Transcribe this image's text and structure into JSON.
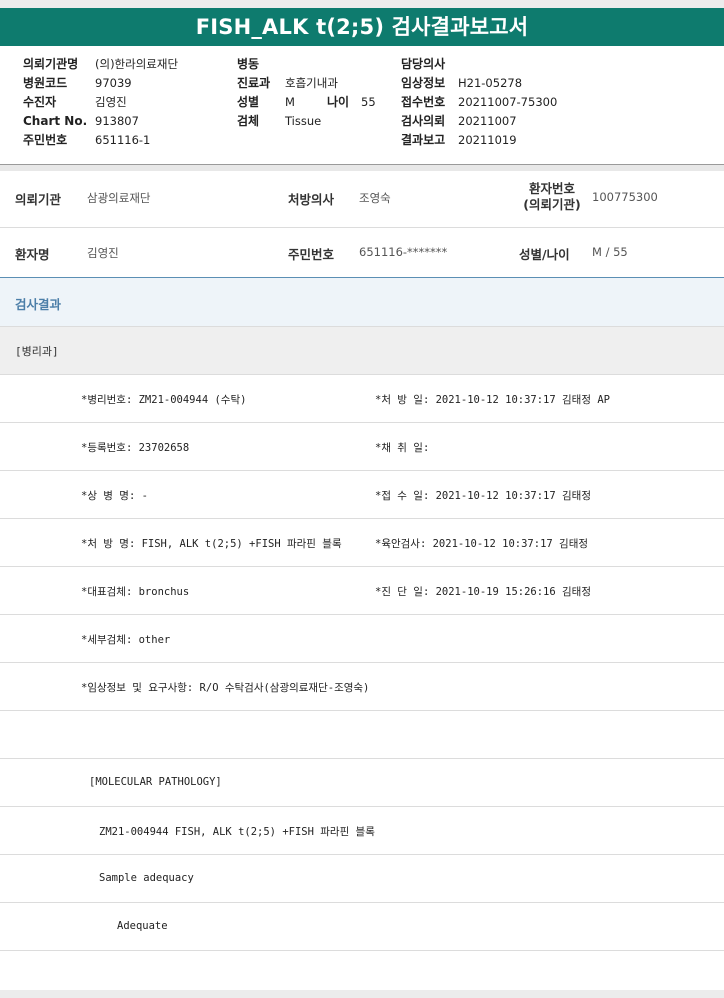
{
  "title": "FISH_ALK t(2;5) 검사결과보고서",
  "header": {
    "col1": [
      {
        "label": "의뢰기관명",
        "value": "(의)한라의료재단"
      },
      {
        "label": "병원코드",
        "value": "97039"
      },
      {
        "label": "수진자",
        "value": "김영진"
      },
      {
        "label": "Chart No.",
        "value": "913807"
      },
      {
        "label": "주민번호",
        "value": "651116-1"
      }
    ],
    "col2": [
      {
        "label": "병동",
        "value": ""
      },
      {
        "label": "진료과",
        "value": "호흡기내과"
      },
      {
        "label": "성별",
        "value": "M"
      },
      {
        "label": "검체",
        "value": "Tissue"
      }
    ],
    "age": {
      "label": "나이",
      "value": "55"
    },
    "col3": [
      {
        "label": "담당의사",
        "value": ""
      },
      {
        "label": "임상정보",
        "value": "H21-05278"
      },
      {
        "label": "접수번호",
        "value": "20211007-75300"
      },
      {
        "label": "검사의뢰",
        "value": "20211007"
      },
      {
        "label": "결과보고",
        "value": "20211019"
      }
    ]
  },
  "info": {
    "row1": {
      "org_label": "의뢰기관",
      "org_value": "삼광의료재단",
      "doctor_label": "처방의사",
      "doctor_value": "조영숙",
      "patno_label_line1": "환자번호",
      "patno_label_line2": "(의뢰기관)",
      "patno_value": "100775300"
    },
    "row2": {
      "name_label": "환자명",
      "name_value": "김영진",
      "ssn_label": "주민번호",
      "ssn_value": "651116-*******",
      "sexage_label": "성별/나이",
      "sexage_value": "M / 55"
    }
  },
  "results": {
    "heading": "검사결과",
    "dept": "[병리과]",
    "rows": [
      {
        "left": "*병리번호: ZM21-004944 (수탁)",
        "right": "*처 방 일: 2021-10-12 10:37:17  김태정 AP"
      },
      {
        "left": "*등록번호: 23702658",
        "right": "*채 취 일:"
      },
      {
        "left": "*상 병 명: -",
        "right": "*접 수 일: 2021-10-12 10:37:17  김태정"
      },
      {
        "left": "*처 방 명: FISH, ALK t(2;5) +FISH 파라핀 블록",
        "right": "*육안검사: 2021-10-12 10:37:17  김태정"
      },
      {
        "left": "*대표검체: bronchus",
        "right": "*진 단 일: 2021-10-19 15:26:16  김태정"
      },
      {
        "left": "*세부검체: other",
        "right": ""
      },
      {
        "left": "*임상정보 및 요구사항: R/O 수탁검사(삼광의료재단-조영숙)",
        "right": ""
      }
    ],
    "molecular": {
      "heading": "[MOLECULAR PATHOLOGY]",
      "line1": "ZM21-004944     FISH, ALK t(2;5) +FISH 파라핀 블록",
      "line2": "Sample adequacy",
      "line3": "Adequate"
    }
  }
}
